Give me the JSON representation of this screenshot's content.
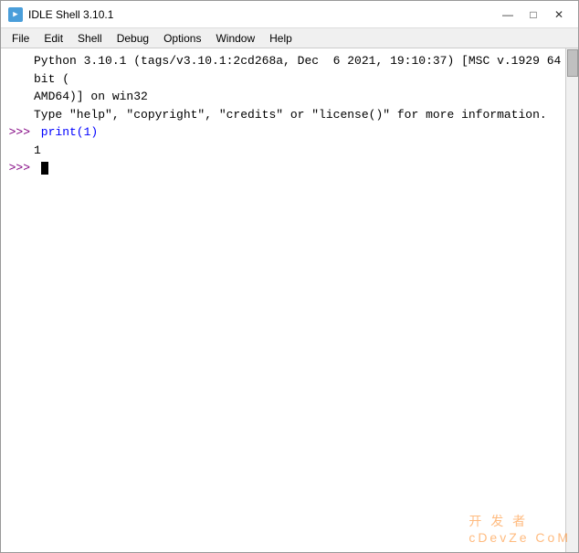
{
  "window": {
    "title": "IDLE Shell 3.10.1",
    "icon_label": "py"
  },
  "controls": {
    "minimize": "—",
    "maximize": "□",
    "close": "✕"
  },
  "menu": {
    "items": [
      "File",
      "Edit",
      "Shell",
      "Debug",
      "Options",
      "Window",
      "Help"
    ]
  },
  "shell": {
    "lines": [
      {
        "type": "output",
        "text": "Python 3.10.1 (tags/v3.10.1:2cd268a, Dec  6 2021, 19:10:37) [MSC v.1929 64 bit ("
      },
      {
        "type": "output",
        "text": "AMD64)] on win32"
      },
      {
        "type": "output",
        "text": "Type \"help\", \"copyright\", \"credits\" or \"license()\" for more information."
      },
      {
        "type": "command",
        "prompt": ">>> ",
        "text": "print(1)"
      },
      {
        "type": "output",
        "text": "1"
      },
      {
        "type": "cursor_line",
        "prompt": ">>> ",
        "text": ""
      }
    ]
  },
  "watermark": "开 发 者\ncDevZe CoM"
}
